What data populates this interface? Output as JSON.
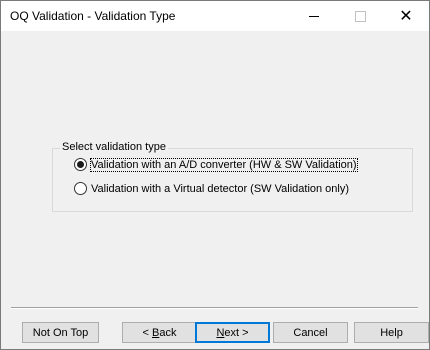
{
  "window": {
    "title": "OQ Validation - Validation Type",
    "controls": {
      "minimize_icon": "minimize-icon",
      "maximize_icon": "maximize-icon",
      "close_icon": "close-icon"
    }
  },
  "group": {
    "label": "Select validation type",
    "options": [
      {
        "label": "Validation with an A/D converter (HW & SW Validation)",
        "selected": true
      },
      {
        "label": "Validation with a Virtual detector (SW Validation only)",
        "selected": false
      }
    ]
  },
  "buttons": {
    "not_on_top": "Not On Top",
    "back_prefix": "< ",
    "back_mnemonic": "B",
    "back_rest": "ack",
    "next_mnemonic": "N",
    "next_rest": "ext >",
    "cancel": "Cancel",
    "help": "Help"
  },
  "colors": {
    "title_bar": "#ffffff",
    "dialog_bg": "#f0f0f0",
    "default_button_border": "#0078d7"
  }
}
